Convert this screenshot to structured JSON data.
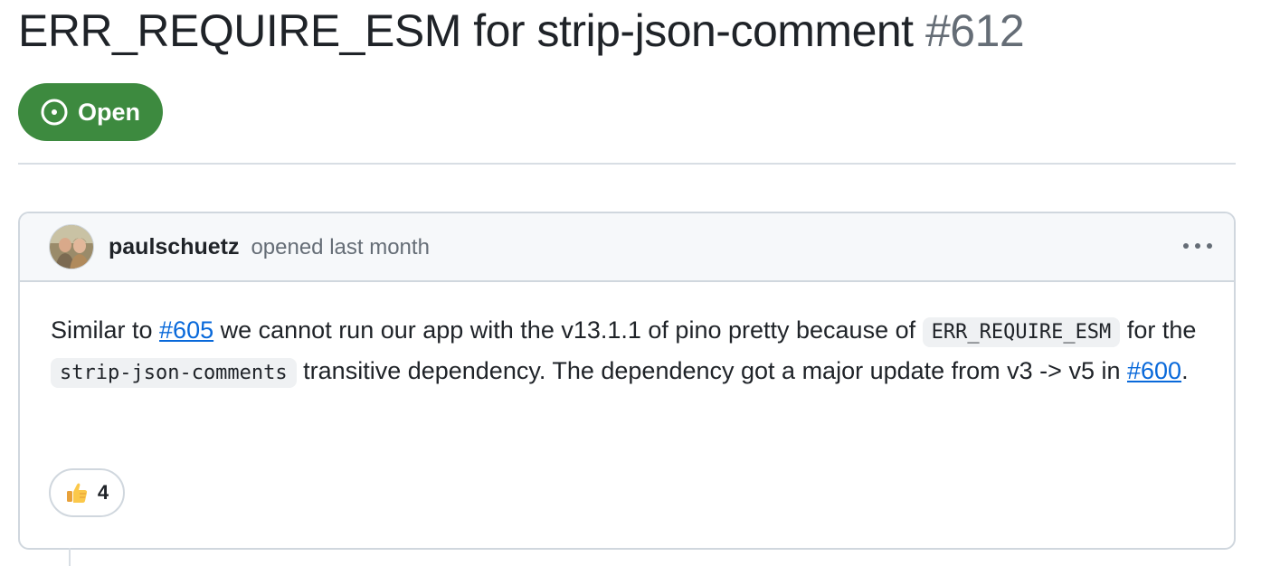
{
  "issue": {
    "title": "ERR_REQUIRE_ESM for strip-json-comment",
    "number": "#612",
    "state": {
      "label": "Open",
      "icon": "issue-opened-icon",
      "color": "#3d8a3f"
    }
  },
  "comment": {
    "author": "paulschuetz",
    "meta": "opened last month",
    "menu_icon": "kebab-horizontal-icon",
    "body": {
      "p1": "Similar to ",
      "link1": "#605",
      "p2": " we cannot run our app with the v13.1.1 of pino pretty because of ",
      "code1": "ERR_REQUIRE_ESM",
      "p3": " for the ",
      "code2": "strip-json-comments",
      "p4": " transitive dependency. The dependency got a major update from v3 -> v5 in ",
      "link2": "#600",
      "p5": "."
    },
    "reaction": {
      "icon": "thumbs-up-icon",
      "count": "4"
    }
  },
  "colors": {
    "link": "#0969da",
    "muted": "#656d76",
    "border": "#d0d7de",
    "header_bg": "#f6f8fa"
  }
}
